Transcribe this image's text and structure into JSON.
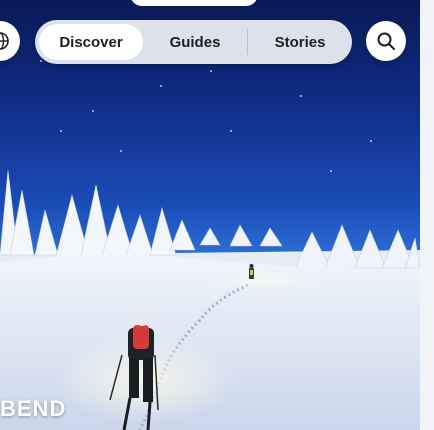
{
  "nav": {
    "tabs": [
      {
        "label": "Discover",
        "active": true
      },
      {
        "label": "Guides",
        "active": false
      },
      {
        "label": "Stories",
        "active": false
      }
    ],
    "globe_icon": "globe-icon",
    "search_icon": "search-icon"
  },
  "hero": {
    "title_fragment": "BEND"
  },
  "colors": {
    "sky_top": "#0a1a55",
    "sky_mid": "#1b4db7",
    "snow": "#e7eef8",
    "tab_active_bg": "#ffffff",
    "tab_bar_bg": "#f0f2f6"
  }
}
